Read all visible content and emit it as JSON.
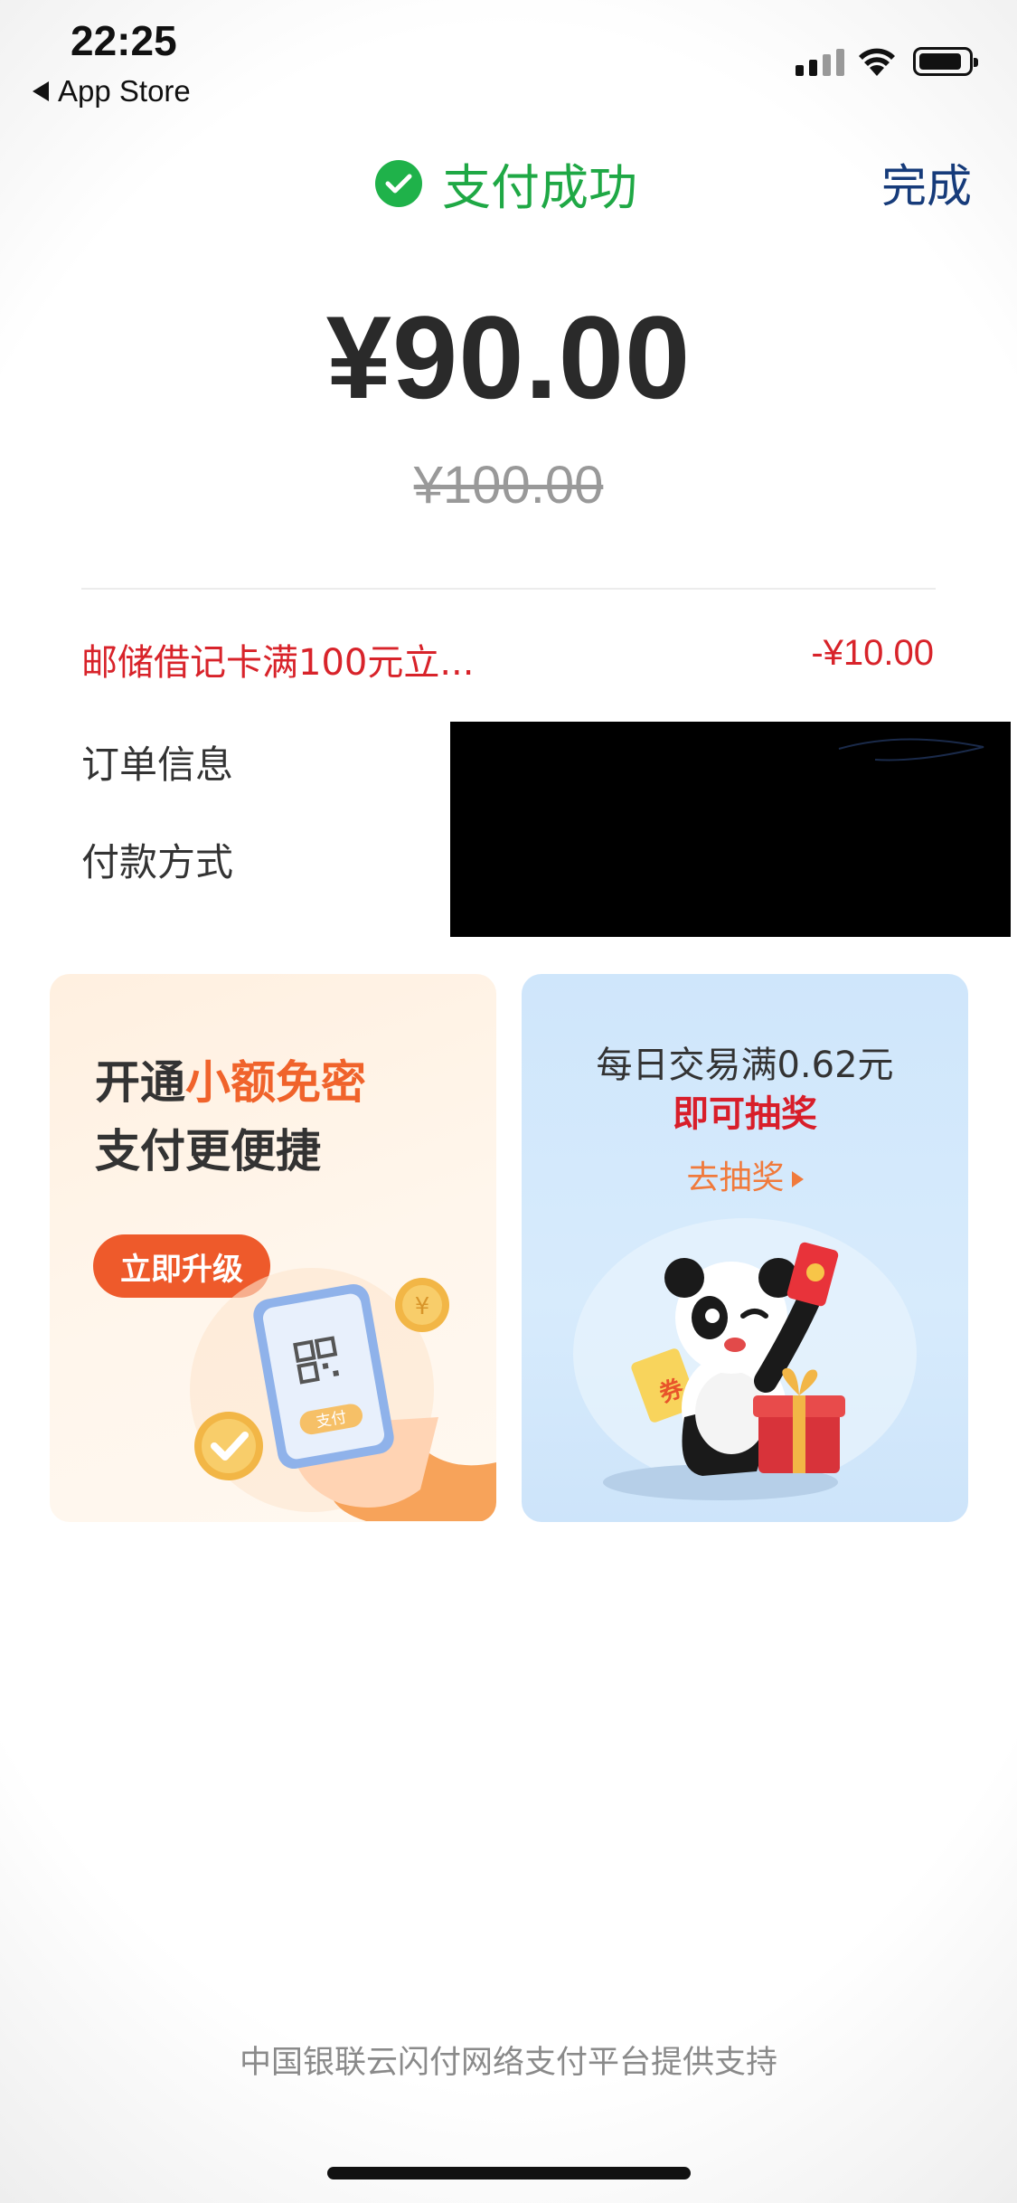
{
  "status_bar": {
    "time": "22:25",
    "back_label": "App Store"
  },
  "header": {
    "status_text": "支付成功",
    "done_label": "完成"
  },
  "payment": {
    "amount": "¥90.00",
    "original_amount": "¥100.00",
    "discount_label": "邮储借记卡满100元立...",
    "discount_value": "-¥10.00",
    "order_info_label": "订单信息",
    "payment_method_label": "付款方式"
  },
  "promo_left": {
    "title_prefix": "开通",
    "title_highlight": "小额免密",
    "title_line2": "支付更便捷",
    "button_label": "立即升级",
    "phone_pay_label": "支付"
  },
  "promo_right": {
    "line1": "每日交易满0.62元",
    "line2": "即可抽奖",
    "link_label": "去抽奖",
    "coupon_label": "券"
  },
  "footer": {
    "text": "中国银联云闪付网络支付平台提供支持"
  },
  "colors": {
    "success_green": "#1fa845",
    "discount_red": "#d8232a",
    "done_blue": "#163b7a",
    "upgrade_orange": "#ee5a2b"
  }
}
